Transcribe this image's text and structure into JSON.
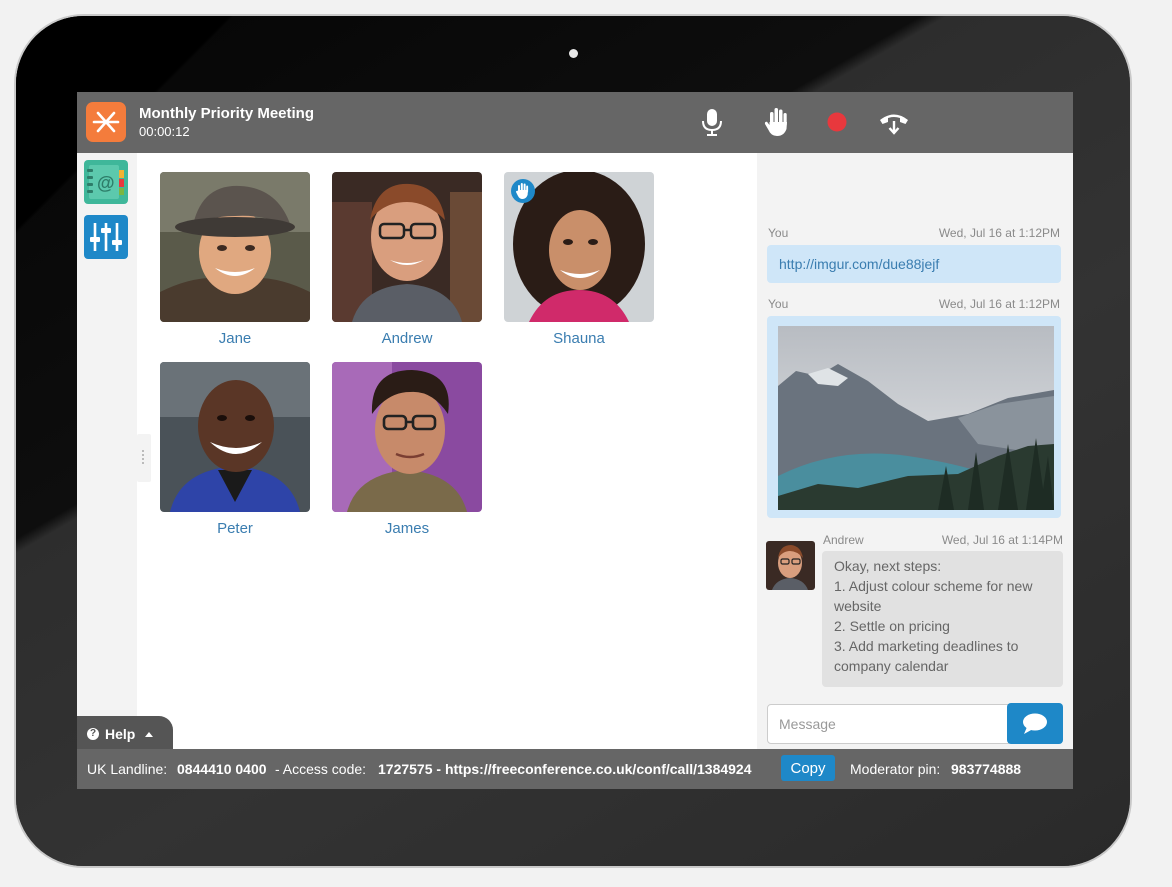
{
  "meeting": {
    "title": "Monthly Priority Meeting",
    "elapsed": "00:00:12"
  },
  "controls": {
    "mic_icon": "microphone-icon",
    "hand_icon": "raise-hand-icon",
    "record_icon": "record-icon",
    "hangup_icon": "hang-up-icon",
    "record_color": "#e8383d"
  },
  "tools": [
    {
      "icon": "address-book-icon"
    },
    {
      "icon": "sliders-icon"
    }
  ],
  "participants": [
    {
      "name": "Jane",
      "hand_raised": false
    },
    {
      "name": "Andrew",
      "hand_raised": false
    },
    {
      "name": "Shauna",
      "hand_raised": true
    },
    {
      "name": "Peter",
      "hand_raised": false
    },
    {
      "name": "James",
      "hand_raised": false
    }
  ],
  "chat": {
    "messages": [
      {
        "sender": "You",
        "time": "Wed, Jul 16 at 1:12PM",
        "type": "link",
        "text": "http://imgur.com/due88jejf"
      },
      {
        "sender": "You",
        "time": "Wed, Jul 16 at 1:12PM",
        "type": "image"
      },
      {
        "sender": "Andrew",
        "time": "Wed, Jul 16 at 1:14PM",
        "type": "text",
        "lines": [
          "Okay, next steps:",
          "1. Adjust colour scheme for new",
          "website",
          "2. Settle on pricing",
          "3. Add marketing deadlines to",
          "company calendar"
        ]
      }
    ],
    "composer": {
      "placeholder": "Message"
    }
  },
  "help": {
    "label": "Help"
  },
  "dial_in": {
    "landline_label": "UK Landline:",
    "landline_number": "0844410 0400",
    "access_label": "- Access code:",
    "access_code_and_url": "1727575 - https://freeconference.co.uk/conf/call/1384924",
    "copy_label": "Copy",
    "moderator_label": "Moderator pin:",
    "moderator_pin": "983774888"
  },
  "colors": {
    "accent": "#1e88c8",
    "brand": "#f47c3c",
    "bar": "#666666",
    "name_link": "#3a7db0"
  }
}
